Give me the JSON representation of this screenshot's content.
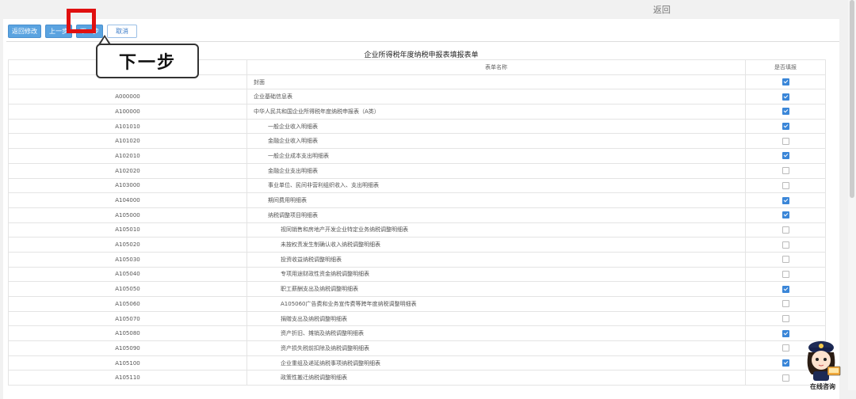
{
  "header": {
    "return_label": "返回"
  },
  "toolbar": {
    "back_modify": "返回修改",
    "prev": "上一步",
    "next": "下一步",
    "cancel": "取消"
  },
  "callout": {
    "text": "下一步"
  },
  "table": {
    "title": "企业所得税年度纳税申报表填报表单",
    "col_name": "表单名称",
    "col_check": "是否填报",
    "rows": [
      {
        "code": "",
        "name": "封面",
        "level": 0,
        "checked": true
      },
      {
        "code": "A000000",
        "name": "企业基础信息表",
        "level": 0,
        "checked": true
      },
      {
        "code": "A100000",
        "name": "中华人民共和国企业所得税年度纳税申报表（A类）",
        "level": 0,
        "checked": true
      },
      {
        "code": "A101010",
        "name": "一般企业收入明细表",
        "level": 1,
        "checked": true
      },
      {
        "code": "A101020",
        "name": "金融企业收入明细表",
        "level": 1,
        "checked": false
      },
      {
        "code": "A102010",
        "name": "一般企业成本支出明细表",
        "level": 1,
        "checked": true
      },
      {
        "code": "A102020",
        "name": "金融企业支出明细表",
        "level": 1,
        "checked": false
      },
      {
        "code": "A103000",
        "name": "事业单位、民间非营利组织收入、支出明细表",
        "level": 1,
        "checked": false
      },
      {
        "code": "A104000",
        "name": "期间费用明细表",
        "level": 1,
        "checked": true
      },
      {
        "code": "A105000",
        "name": "纳税调整项目明细表",
        "level": 1,
        "checked": true
      },
      {
        "code": "A105010",
        "name": "视同销售和房地产开发企业特定业务纳税调整明细表",
        "level": 2,
        "checked": false
      },
      {
        "code": "A105020",
        "name": "未按权责发生制确认收入纳税调整明细表",
        "level": 2,
        "checked": false
      },
      {
        "code": "A105030",
        "name": "投资收益纳税调整明细表",
        "level": 2,
        "checked": false
      },
      {
        "code": "A105040",
        "name": "专项用途财政性资金纳税调整明细表",
        "level": 2,
        "checked": false
      },
      {
        "code": "A105050",
        "name": "职工薪酬支出及纳税调整明细表",
        "level": 2,
        "checked": true
      },
      {
        "code": "A105060",
        "name": "A105060广告费和业务宣传费等跨年度纳税调整明细表",
        "level": 2,
        "checked": false
      },
      {
        "code": "A105070",
        "name": "捐赠支出及纳税调整明细表",
        "level": 2,
        "checked": false
      },
      {
        "code": "A105080",
        "name": "资产折旧、摊销及纳税调整明细表",
        "level": 2,
        "checked": true
      },
      {
        "code": "A105090",
        "name": "资产损失税前扣除及纳税调整明细表",
        "level": 2,
        "checked": false
      },
      {
        "code": "A105100",
        "name": "企业重组及递延纳税事项纳税调整明细表",
        "level": 2,
        "checked": true
      },
      {
        "code": "A105110",
        "name": "政策性搬迁纳税调整明细表",
        "level": 2,
        "checked": false
      }
    ]
  },
  "mascot": {
    "caption": "在线咨询",
    "name": "mascot"
  }
}
